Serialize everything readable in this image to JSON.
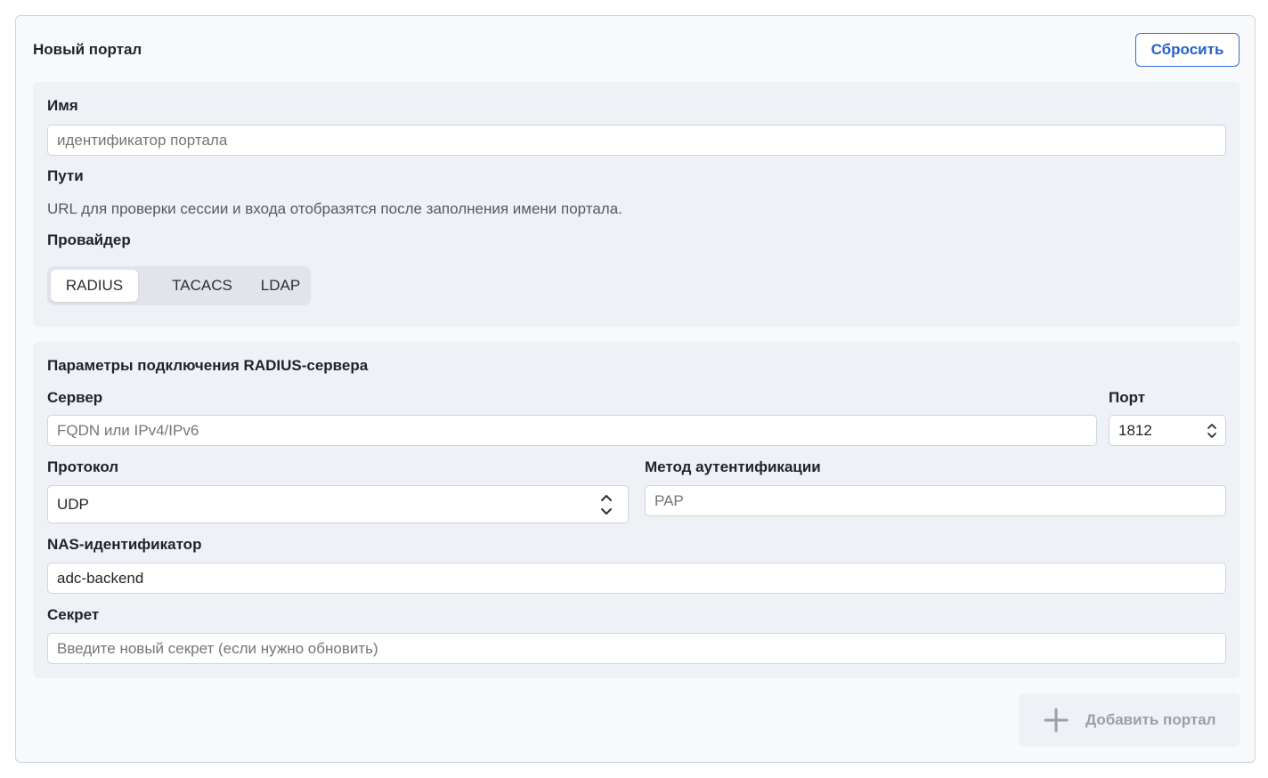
{
  "card": {
    "title": "Новый портал",
    "reset_label": "Сбросить"
  },
  "basic": {
    "name_label": "Имя",
    "name_placeholder": "идентификатор портала",
    "paths_label": "Пути",
    "paths_hint": "URL для проверки сессии и входа отобразятся после заполнения имени портала.",
    "provider_label": "Провайдер",
    "providers": [
      "RADIUS",
      "TACACS",
      "LDAP"
    ],
    "selected_provider": "RADIUS"
  },
  "connection": {
    "title": "Параметры подключения RADIUS-сервера",
    "server_label": "Сервер",
    "server_placeholder": "FQDN или IPv4/IPv6",
    "port_label": "Порт",
    "port_value": "1812",
    "protocol_label": "Протокол",
    "protocol_value": "UDP",
    "auth_label": "Метод аутентификации",
    "auth_placeholder": "PAP",
    "nas_label": "NAS-идентификатор",
    "nas_value": "adc-backend",
    "secret_label": "Секрет",
    "secret_placeholder": "Введите новый секрет (если нужно обновить)"
  },
  "footer": {
    "add_label": "Добавить портал",
    "add_icon": "plus-icon"
  },
  "colors": {
    "accent": "#2563c4",
    "section_bg": "#eef1f5",
    "disabled_text": "#9aa0a8"
  }
}
